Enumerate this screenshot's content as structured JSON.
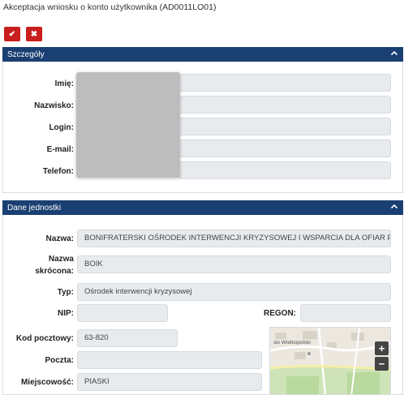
{
  "title": "Akceptacja wniosku o konto użytkownika (AD0011LO01)",
  "actions": {
    "accept_icon": "✔",
    "reject_icon": "✖"
  },
  "details": {
    "header": "Szczegóły",
    "fields": {
      "imie": {
        "label": "Imię:",
        "value": ""
      },
      "nazwisko": {
        "label": "Nazwisko:",
        "value": ""
      },
      "login": {
        "label": "Login:",
        "value": ""
      },
      "email": {
        "label": "E-mail:",
        "value": ""
      },
      "telefon": {
        "label": "Telefon:",
        "value": ""
      }
    }
  },
  "unit": {
    "header": "Dane jednostki",
    "nazwa": {
      "label": "Nazwa:",
      "value": "BONIFRATERSKI OŚRODEK INTERWENCJI KRYZYSOWEJ I WSPARCIA DLA OFIAR PRZEM"
    },
    "skrot": {
      "label_line1": "Nazwa",
      "label_line2": "skrócona:",
      "value": "BOIK"
    },
    "typ": {
      "label": "Typ:",
      "value": "Ośrodek interwencji kryzysowej"
    },
    "nip": {
      "label": "NIP:",
      "value": ""
    },
    "regon": {
      "label": "REGON:",
      "value": ""
    },
    "kod": {
      "label": "Kod pocztowy:",
      "value": "63-820"
    },
    "poczta": {
      "label": "Poczta:",
      "value": ""
    },
    "miejscowosc": {
      "label": "Miejscowość:",
      "value": "PIASKI"
    }
  },
  "map": {
    "zoom_in": "+",
    "zoom_out": "−",
    "place_label": "ski Wielkopolski"
  },
  "icons": {
    "collapse": "chevron-up-icon",
    "accept": "check-icon",
    "reject": "close-icon"
  },
  "colors": {
    "header_bg": "#1a3f72",
    "button_bg": "#c81e1e",
    "field_bg": "#e8ebee"
  }
}
